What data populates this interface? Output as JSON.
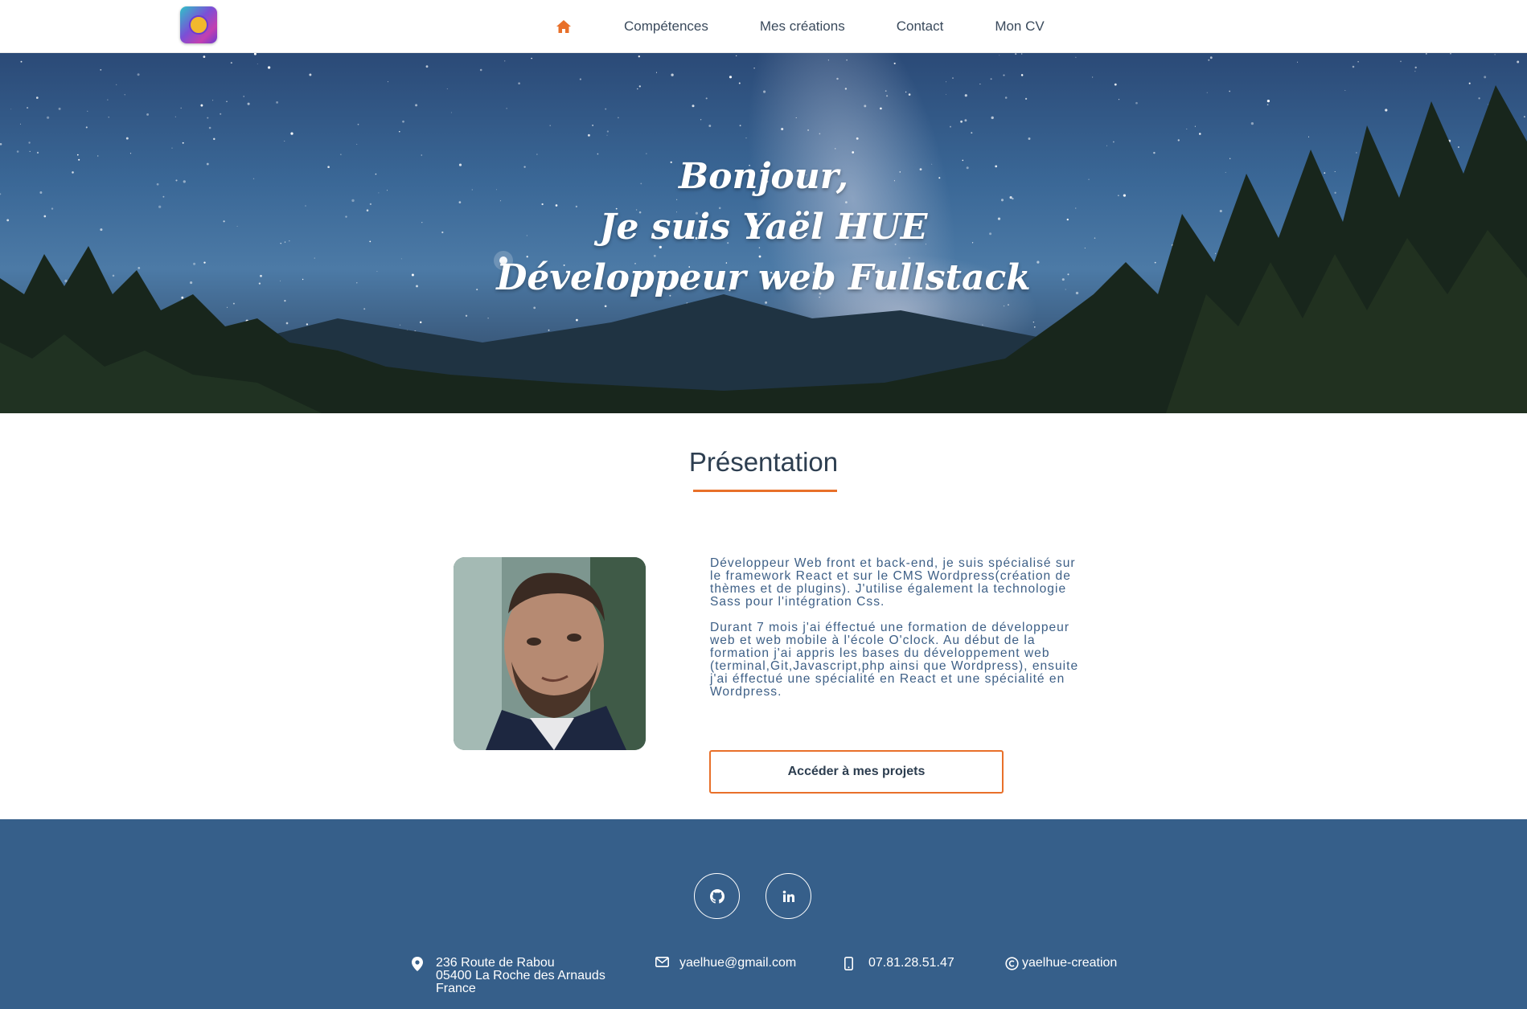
{
  "header": {
    "logo": "logo-icon",
    "nav": {
      "home_icon": "home-icon",
      "items": [
        "Compétences",
        "Mes créations",
        "Contact",
        "Mon CV"
      ]
    }
  },
  "hero": {
    "lines": [
      "Bonjour,",
      "Je suis Yaël HUE",
      "Développeur web Fullstack"
    ]
  },
  "presentation": {
    "title": "Présentation",
    "paragraphs": [
      "Développeur Web front et back-end, je suis spécialisé sur le framework React et sur le CMS Wordpress(création de thèmes et de plugins). J'utilise également la technologie Sass pour l'intégration Css.",
      "Durant 7 mois j'ai éffectué une formation de développeur web et web mobile à l'école O'clock. Au début de la formation j'ai appris les bases du développement web (terminal,Git,Javascript,php ainsi que Wordpress), ensuite j'ai éffectué une spécialité en React et une spécialité en Wordpress."
    ],
    "cta_label": "Accéder à mes projets"
  },
  "footer": {
    "social": [
      "github-icon",
      "linkedin-icon"
    ],
    "address": [
      "236 Route de Rabou",
      "05400 La Roche des Arnauds",
      "France"
    ],
    "email": "yaelhue@gmail.com",
    "phone": "07.81.28.51.47",
    "copyright": "yaelhue-creation"
  },
  "colors": {
    "accent": "#e8702a",
    "footer_bg": "#365f8a",
    "heading": "#2d3e50",
    "body_text": "#3d5f86"
  }
}
